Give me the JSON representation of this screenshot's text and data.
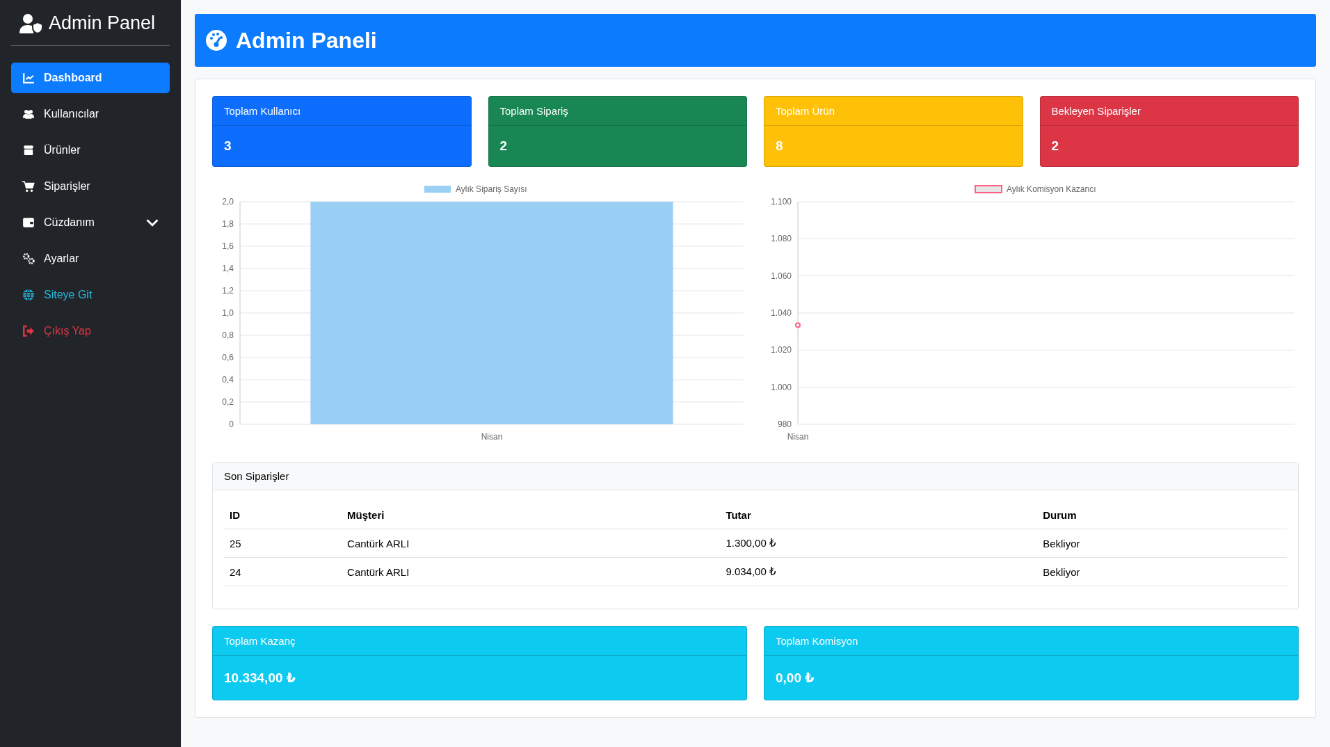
{
  "sidebar": {
    "brand": "Admin Panel",
    "items": [
      {
        "label": "Dashboard",
        "kind": "nav",
        "selected": true
      },
      {
        "label": "Kullanıcılar",
        "kind": "nav",
        "selected": false
      },
      {
        "label": "Ürünler",
        "kind": "nav",
        "selected": false
      },
      {
        "label": "Siparişler",
        "kind": "nav",
        "selected": false
      },
      {
        "label": "Cüzdanım",
        "kind": "nav",
        "selected": false,
        "expanded": false
      },
      {
        "label": "Ayarlar",
        "kind": "nav",
        "selected": false
      },
      {
        "label": "Siteye Git",
        "kind": "external",
        "selected": false
      },
      {
        "label": "Çıkış Yap",
        "kind": "logout",
        "selected": false
      }
    ]
  },
  "header": {
    "title": "Admin Paneli"
  },
  "stats": [
    {
      "title": "Toplam Kullanıcı",
      "value": "3",
      "color": "#0d6efd"
    },
    {
      "title": "Toplam Sipariş",
      "value": "2",
      "color": "#198754"
    },
    {
      "title": "Toplam Ürün",
      "value": "8",
      "color": "#ffc107"
    },
    {
      "title": "Bekleyen Siparişler",
      "value": "2",
      "color": "#dc3545"
    }
  ],
  "charts": [
    {
      "chart_data": {
        "type": "bar",
        "categories": [
          "Nisan"
        ],
        "series": [
          {
            "name": "Aylık Sipariş Sayısı",
            "color": "#9ad0f5",
            "values": [
              2
            ]
          }
        ],
        "ylim": [
          0,
          2
        ],
        "grid": true,
        "yticks": [
          {
            "value": 0,
            "label": "0"
          },
          {
            "value": 0.2,
            "label": "0,2"
          },
          {
            "value": 0.4,
            "label": "0,4"
          },
          {
            "value": 0.6,
            "label": "0,6"
          },
          {
            "value": 0.8,
            "label": "0,8"
          },
          {
            "value": 1,
            "label": "1,0"
          },
          {
            "value": 1.2,
            "label": "1,2"
          },
          {
            "value": 1.4,
            "label": "1,4"
          },
          {
            "value": 1.6,
            "label": "1,6"
          },
          {
            "value": 1.8,
            "label": "1,8"
          },
          {
            "value": 2,
            "label": "2,0"
          }
        ]
      }
    },
    {
      "chart_data": {
        "type": "line",
        "categories": [
          "Nisan"
        ],
        "series": [
          {
            "name": "Aylık Komisyon Kazancı",
            "color": "#ff6384",
            "values": [
              1033.4
            ],
            "marker": true
          }
        ],
        "ylim": [
          980,
          1100
        ],
        "grid": true,
        "yticks": [
          {
            "value": 980,
            "label": "980"
          },
          {
            "value": 1000,
            "label": "1.000"
          },
          {
            "value": 1020,
            "label": "1.020"
          },
          {
            "value": 1040,
            "label": "1.040"
          },
          {
            "value": 1060,
            "label": "1.060"
          },
          {
            "value": 1080,
            "label": "1.080"
          },
          {
            "value": 1100,
            "label": "1.100"
          }
        ]
      }
    }
  ],
  "orders": {
    "title": "Son Siparişler",
    "columns": [
      "ID",
      "Müşteri",
      "Tutar",
      "Durum"
    ],
    "rows": [
      [
        "25",
        "Cantürk ARLI",
        "1.300,00 ₺",
        "Bekliyor"
      ],
      [
        "24",
        "Cantürk ARLI",
        "9.034,00 ₺",
        "Bekliyor"
      ]
    ]
  },
  "totals": [
    {
      "title": "Toplam Kazanç",
      "value": "10.334,00 ₺",
      "color": "#0dcaf0"
    },
    {
      "title": "Toplam Komisyon",
      "value": "0,00 ₺",
      "color": "#0dcaf0"
    }
  ]
}
